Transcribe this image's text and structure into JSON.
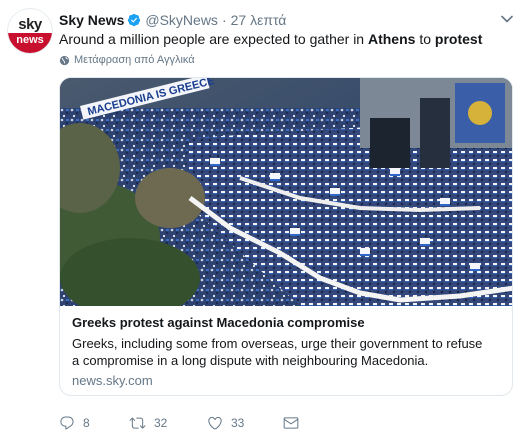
{
  "tweet": {
    "author": {
      "name": "Sky News",
      "handle": "@SkyNews",
      "avatar_text_top": "sky",
      "avatar_text_bottom": "news"
    },
    "separator": "·",
    "time": "27 λεπτά",
    "text_parts": [
      "Around a million people are expected to gather in ",
      "Athens",
      " to ",
      "protest"
    ],
    "translate_label": "Μετάφραση από Αγγλικά",
    "card": {
      "image_banner_text": "MACEDONIA IS GREECE",
      "title": "Greeks protest against Macedonia compromise",
      "description": "Greeks, including some from overseas, urge their government to refuse a compromise in a long dispute with neighbouring Macedonia.",
      "domain": "news.sky.com"
    },
    "actions": {
      "reply_count": "8",
      "retweet_count": "32",
      "like_count": "33"
    }
  },
  "colors": {
    "verified": "#1da1f2",
    "secondary_text": "#657786",
    "sky_red": "#c8102e"
  },
  "icons": [
    "verified-badge-icon",
    "chevron-down-icon",
    "globe-icon",
    "reply-icon",
    "retweet-icon",
    "like-icon",
    "message-icon"
  ]
}
